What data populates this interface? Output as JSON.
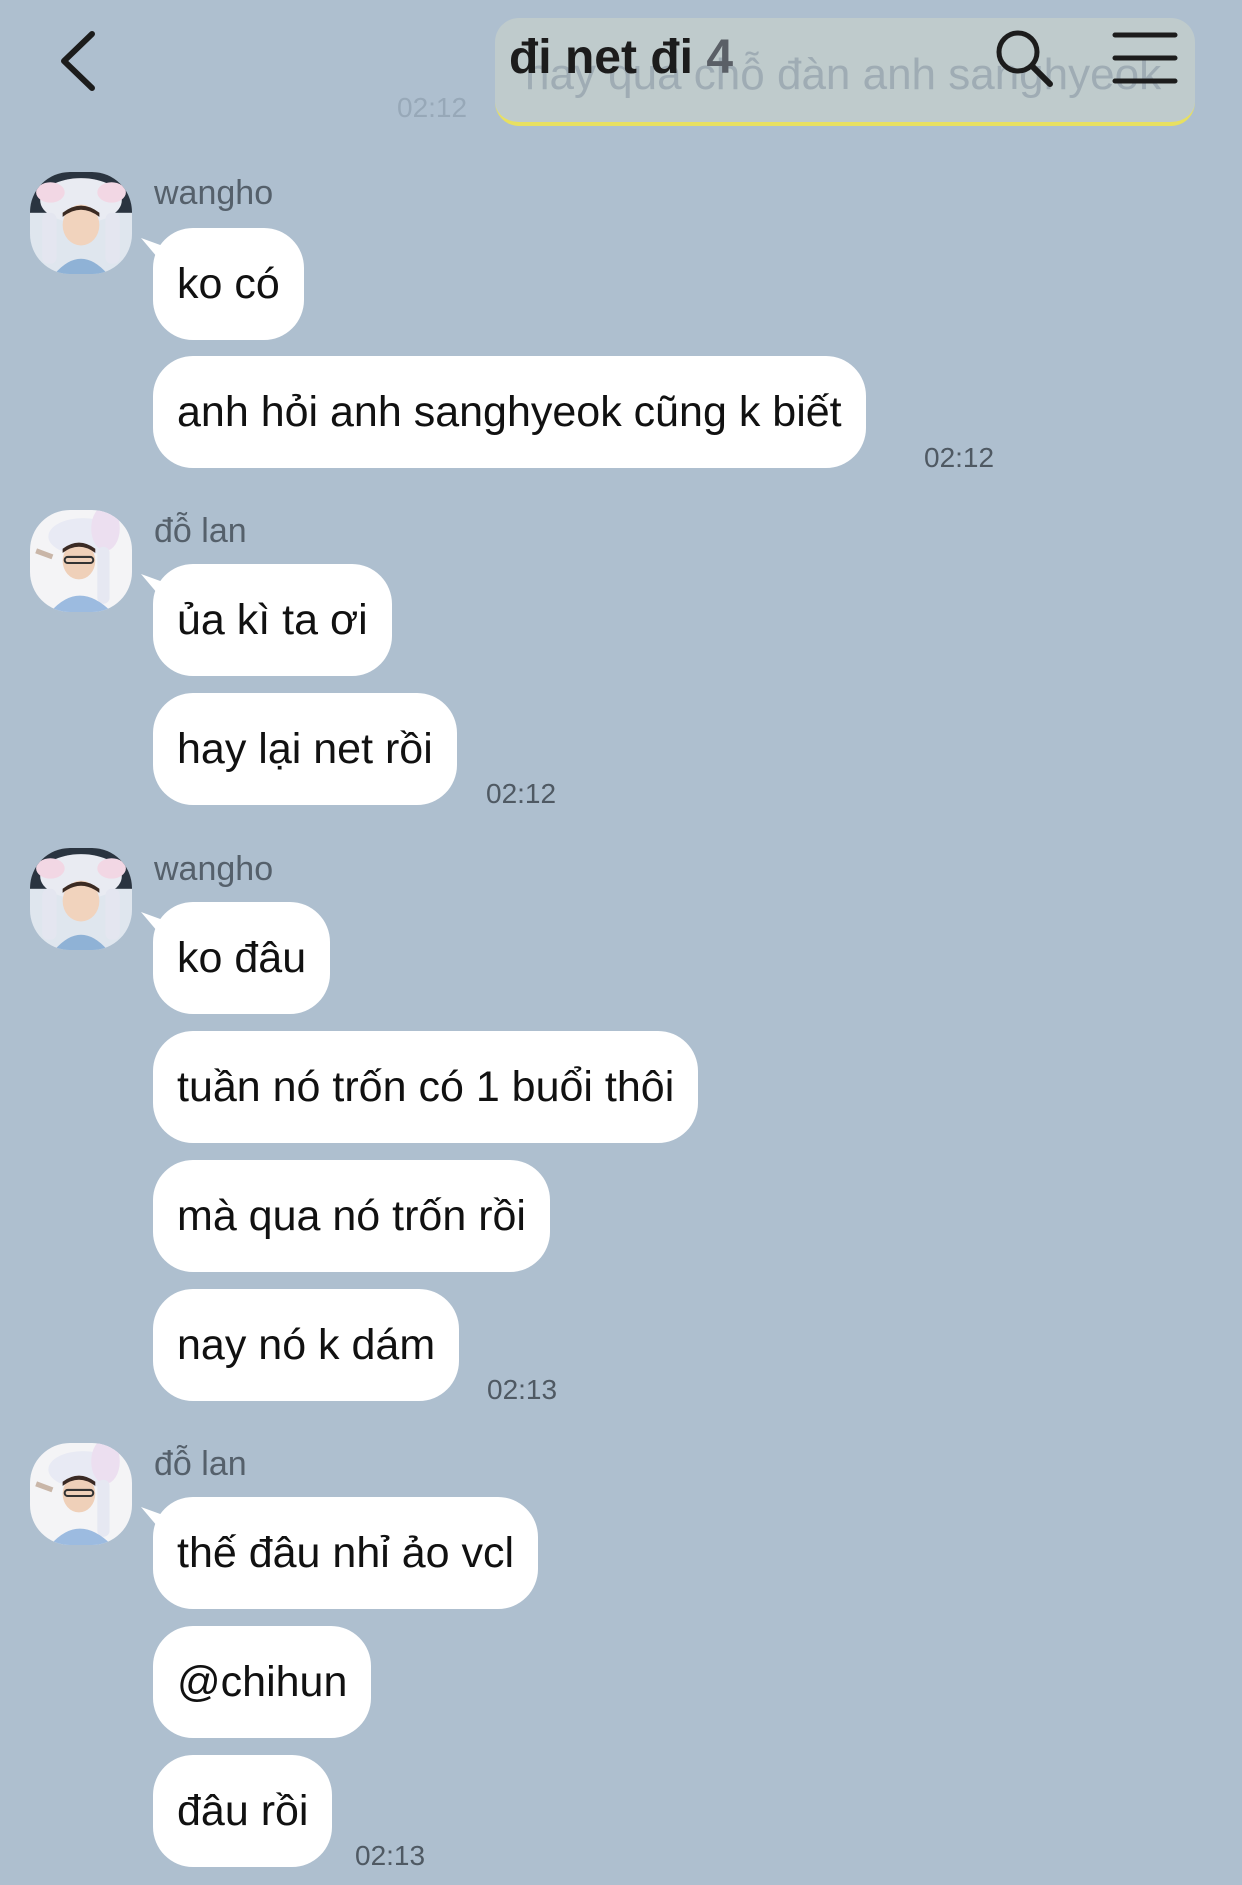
{
  "header": {
    "title": "đi net đi",
    "member_count": "4",
    "background_preview_text": "hay qua chỗ đàn anh sanghyeok",
    "background_preview_time": "02:12",
    "back_icon": "chevron-left-icon",
    "search_icon": "search-icon",
    "menu_icon": "hamburger-menu-icon"
  },
  "messages": [
    {
      "sender": "wangho",
      "avatar": "avatar-wangho",
      "bubbles": [
        "ko có",
        "anh hỏi anh sanghyeok cũng k biết"
      ],
      "time": "02:12"
    },
    {
      "sender": "đỗ lan",
      "avatar": "avatar-do-lan",
      "bubbles": [
        "ủa kì ta ơi",
        "hay lại net rồi"
      ],
      "time": "02:12"
    },
    {
      "sender": "wangho",
      "avatar": "avatar-wangho",
      "bubbles": [
        "ko đâu",
        "tuần nó trốn có 1 buổi thôi",
        "mà qua nó trốn rồi",
        "nay nó k dám"
      ],
      "time": "02:13"
    },
    {
      "sender": "đỗ lan",
      "avatar": "avatar-do-lan",
      "bubbles": [
        "thế đâu nhỉ ảo vcl",
        "@chihun",
        "đâu rồi"
      ],
      "time": "02:13"
    }
  ],
  "colors": {
    "background": "#aebfcf",
    "bubble": "#ffffff",
    "text": "#111111",
    "timestamp": "#4f5963",
    "highlight_underline": "#e8e060"
  }
}
